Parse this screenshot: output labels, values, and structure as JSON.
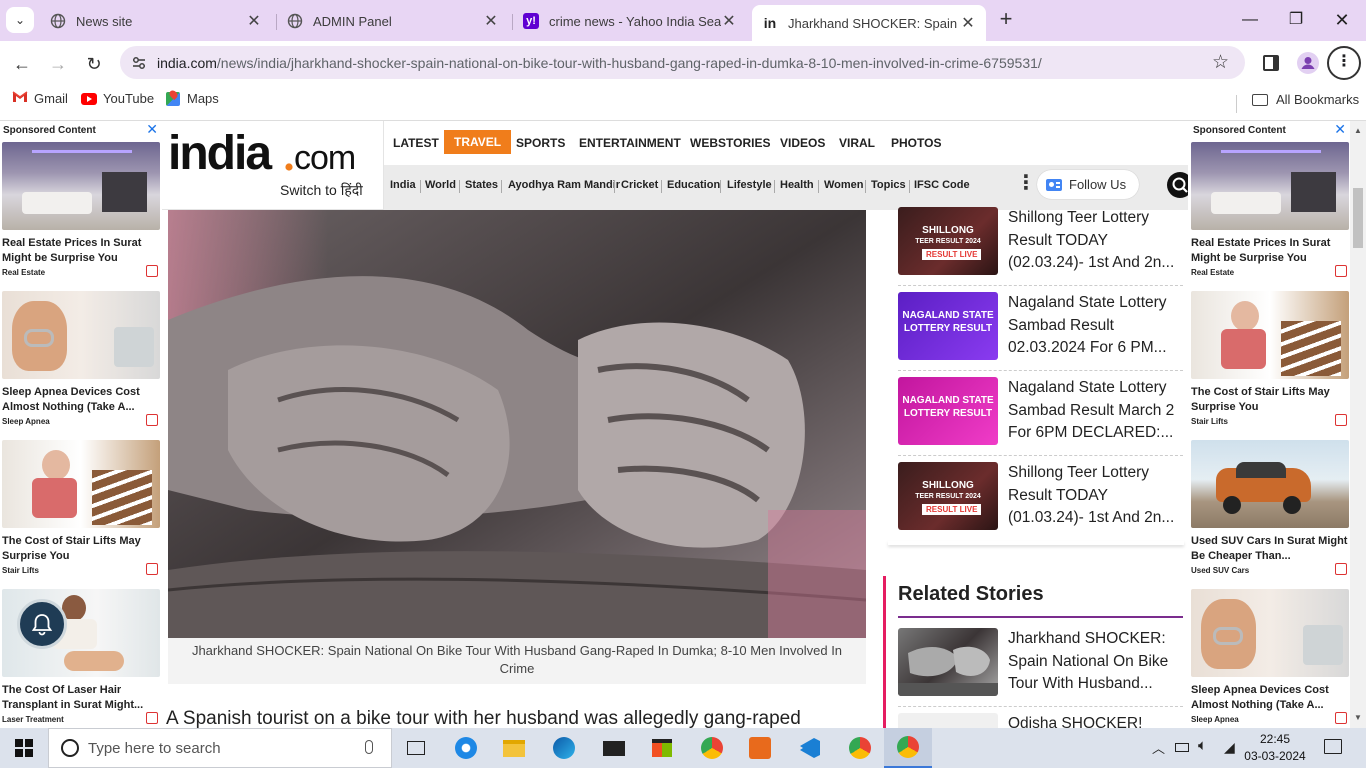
{
  "browser": {
    "tabs": [
      {
        "title": "News site",
        "icon": "globe-icon",
        "active": false
      },
      {
        "title": "ADMIN Panel",
        "icon": "globe-icon",
        "active": false
      },
      {
        "title": "crime news - Yahoo India Search",
        "icon": "yahoo-icon",
        "active": false
      },
      {
        "title": "Jharkhand SHOCKER: Spain National On Bike Tour",
        "icon": "india-com-icon",
        "active": true
      }
    ],
    "url_host": "india.com",
    "url_path": "/news/india/jharkhand-shocker-spain-national-on-bike-tour-with-husband-gang-raped-in-dumka-8-10-men-involved-in-crime-6759531/",
    "bookmarks": [
      {
        "label": "Gmail",
        "icon": "gmail-icon"
      },
      {
        "label": "YouTube",
        "icon": "youtube-icon"
      },
      {
        "label": "Maps",
        "icon": "maps-icon"
      }
    ],
    "all_bookmarks": "All Bookmarks"
  },
  "left_ads": {
    "header": "Sponsored Content",
    "items": [
      {
        "title": "Real Estate Prices In Surat Might be Surprise You",
        "source": "Real Estate",
        "image": "living-room"
      },
      {
        "title": "Sleep Apnea Devices Cost Almost Nothing (Take A...",
        "source": "Sleep Apnea",
        "image": "sleep-mask"
      },
      {
        "title": "The Cost of Stair Lifts May Surprise You",
        "source": "Stair Lifts",
        "image": "stair-lift"
      },
      {
        "title": "The Cost Of Laser Hair Transplant in Surat Might...",
        "source": "Laser Treatment",
        "image": "laser"
      }
    ]
  },
  "right_ads": {
    "header": "Sponsored Content",
    "items": [
      {
        "title": "Real Estate Prices In Surat Might be Surprise You",
        "source": "Real Estate",
        "image": "living-room"
      },
      {
        "title": "The Cost of Stair Lifts May Surprise You",
        "source": "Stair Lifts",
        "image": "stair-lift"
      },
      {
        "title": "Used SUV Cars In Surat Might Be Cheaper Than...",
        "source": "Used SUV Cars",
        "image": "suv"
      },
      {
        "title": "Sleep Apnea Devices Cost Almost Nothing (Take A...",
        "source": "Sleep Apnea",
        "image": "sleep-mask"
      }
    ]
  },
  "site": {
    "logo_text": "india.com",
    "switch_label": "Switch to हिंदी",
    "main_nav": [
      "LATEST",
      "TRAVEL",
      "SPORTS",
      "ENTERTAINMENT",
      "WEBSTORIES",
      "VIDEOS",
      "VIRAL",
      "PHOTOS"
    ],
    "sub_nav": [
      "India",
      "World",
      "States",
      "Ayodhya Ram Mandir",
      "Cricket",
      "Education",
      "Lifestyle",
      "Health",
      "Women",
      "Topics",
      "IFSC Code"
    ],
    "follow_label": "Follow Us"
  },
  "article": {
    "caption": "Jharkhand SHOCKER: Spain National On Bike Tour With Husband Gang-Raped In Dumka; 8-10 Men Involved In Crime",
    "lede": "A Spanish tourist on a bike tour with her husband was allegedly gang-raped"
  },
  "rail": {
    "stories": [
      {
        "title": "Shillong Teer Lottery Result TODAY (02.03.24)- 1st And 2n...",
        "thumb_style": "shillong",
        "thumb_l1": "SHILLONG",
        "thumb_l2": "TEER RESULT 2024",
        "thumb_badge": "RESULT LIVE"
      },
      {
        "title": "Nagaland State Lottery Sambad Result 02.03.2024 For 6 PM...",
        "thumb_style": "nagaland-purple",
        "thumb_l1": "NAGALAND STATE",
        "thumb_l2": "LOTTERY RESULT",
        "thumb_badge": ""
      },
      {
        "title": "Nagaland State Lottery Sambad Result March 2 For 6PM DECLARED:...",
        "thumb_style": "nagaland-pink",
        "thumb_l1": "NAGALAND STATE",
        "thumb_l2": "LOTTERY RESULT",
        "thumb_badge": ""
      },
      {
        "title": "Shillong Teer Lottery Result TODAY (01.03.24)- 1st And 2n...",
        "thumb_style": "shillong",
        "thumb_l1": "SHILLONG",
        "thumb_l2": "TEER RESULT 2024",
        "thumb_badge": "RESULT LIVE"
      }
    ],
    "related_title": "Related Stories",
    "related": [
      {
        "title": "Jharkhand SHOCKER: Spain National On Bike Tour With Husband...",
        "thumb_style": "fists"
      },
      {
        "title": "Odisha SHOCKER!",
        "thumb_style": "light"
      }
    ]
  },
  "taskbar": {
    "search_placeholder": "Type here to search",
    "time": "22:45",
    "date": "03-03-2024"
  }
}
